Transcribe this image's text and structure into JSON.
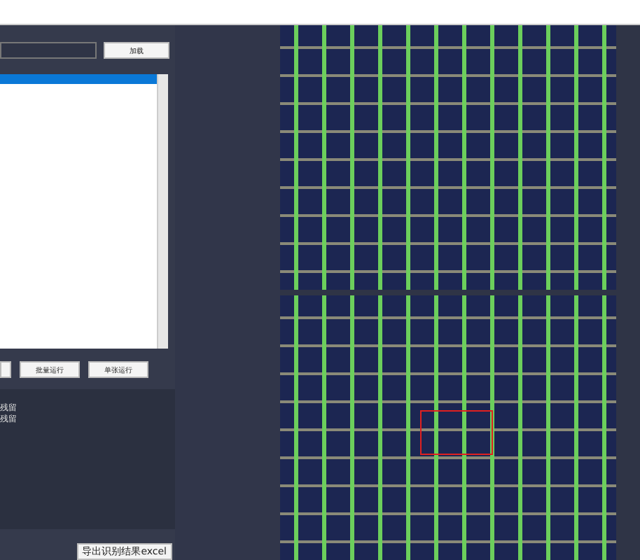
{
  "load_button": "加载",
  "file_list": {
    "items": [
      {
        "selected": true
      }
    ]
  },
  "run_buttons": [
    "批量运行",
    "单张运行"
  ],
  "log_lines": [
    "残留",
    "残留"
  ],
  "export_button": "导出识别结果excel",
  "images": [
    {
      "kind": "plain"
    },
    {
      "kind": "detected"
    }
  ]
}
